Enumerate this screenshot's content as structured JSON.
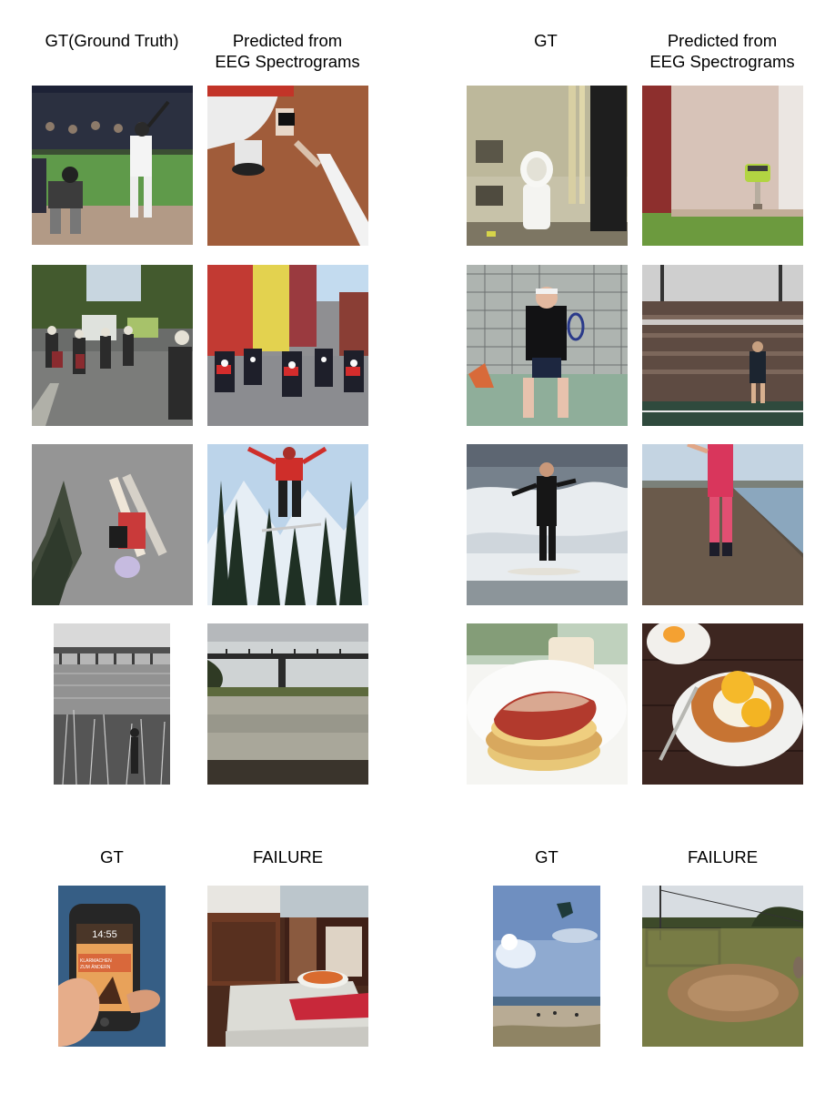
{
  "headers": {
    "left_gt": "GT(Ground Truth)",
    "left_pred": "Predicted from\nEEG Spectrograms",
    "right_gt": "GT",
    "right_pred": "Predicted from\nEEG Spectrograms",
    "fail_left_gt": "GT",
    "fail_left_pred": "FAILURE",
    "fail_right_gt": "GT",
    "fail_right_pred": "FAILURE"
  },
  "phone": {
    "time": "14:55",
    "banner": "KLARMACHEN\nZUM ÄNDERN"
  }
}
